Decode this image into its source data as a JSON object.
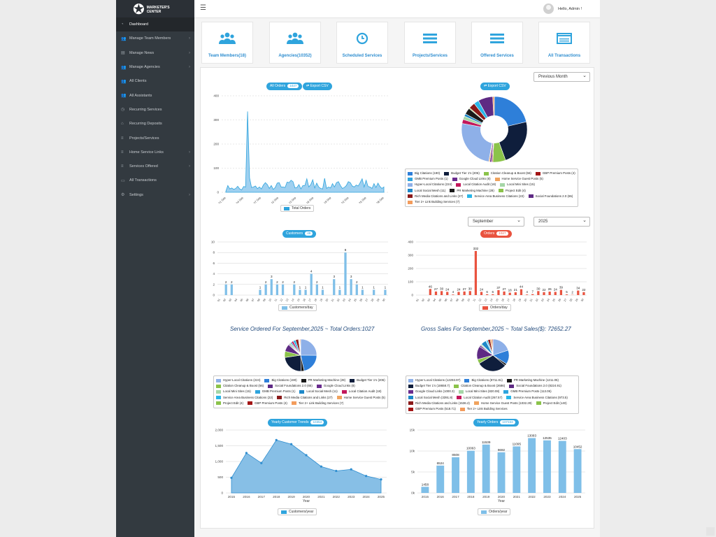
{
  "app": {
    "logo_text": "MARKETER'S CENTER",
    "greeting": "Hello, Admin !"
  },
  "sidebar": {
    "items": [
      {
        "label": "Dashboard",
        "icon": "dashboard-icon",
        "active": true,
        "arrow": false
      },
      {
        "label": "Manage Team Members",
        "icon": "users-icon",
        "arrow": true
      },
      {
        "label": "Manage News",
        "icon": "news-icon",
        "arrow": true
      },
      {
        "label": "Manage Agencies",
        "icon": "users-icon",
        "arrow": true
      },
      {
        "label": "All Clients",
        "icon": "users-icon",
        "arrow": false
      },
      {
        "label": "All Assistants",
        "icon": "users-icon",
        "arrow": false
      },
      {
        "label": "Recurring Services",
        "icon": "clock-icon",
        "arrow": false
      },
      {
        "label": "Recurring Deposits",
        "icon": "bank-icon",
        "arrow": false
      },
      {
        "label": "Projects/Services",
        "icon": "list-icon",
        "arrow": false
      },
      {
        "label": "Home Service Links",
        "icon": "list-icon",
        "arrow": true
      },
      {
        "label": "Services Offered",
        "icon": "list-icon",
        "arrow": true
      },
      {
        "label": "All Transactions",
        "icon": "card-icon",
        "arrow": false
      },
      {
        "label": "Settings",
        "icon": "gear-icon",
        "arrow": true
      }
    ]
  },
  "cards": [
    {
      "label": "Team Members(18)",
      "icon": "users-icon"
    },
    {
      "label": "Agencies(10352)",
      "icon": "users-icon"
    },
    {
      "label": "Scheduled Services",
      "icon": "clock-icon"
    },
    {
      "label": "Projects/Services",
      "icon": "list-icon"
    },
    {
      "label": "Offered Services",
      "icon": "list-icon"
    },
    {
      "label": "All Transactions",
      "icon": "card-icon"
    }
  ],
  "filters": {
    "period": "Previous Month",
    "month": "September",
    "year": "2025"
  },
  "buttons": {
    "all_orders": "All Orders",
    "all_orders_count": "1027",
    "export_csv": "Export CSV",
    "export_csv_2": "Export CSV"
  },
  "badges": {
    "customers": "Customers",
    "customers_count": "49",
    "orders": "Orders",
    "orders_count": "1027",
    "yearly_customers": "Yearly Customer Trends",
    "yearly_customers_count": "10354",
    "yearly_orders": "Yearly Orders",
    "yearly_orders_count": "107333"
  },
  "colors": {
    "accent": "#2fa4dd",
    "red": "#e9533f",
    "sidebar": "#333a40",
    "area": "#87bfe6",
    "bar": "#7fbfe8"
  },
  "palette": {
    "Big Citations": "#2e7fd9",
    "Budget Tier 1's": "#0f1e3c",
    "Citation Cleanup & Boost": "#8bc34a",
    "GBP Premium Posts": "#a31515",
    "GMB Premium Posts": "#2fa4dd",
    "Google Cloud Links": "#6a2c8e",
    "Home Service Guest Posts": "#f0a35e",
    "Hyper-Local Citations": "#8eb0e8",
    "Local Citation Audit": "#c2185b",
    "Local Mini Sites": "#a5d6a7",
    "Local Social Mesh": "#1e88c8",
    "PR Marketing Machine": "#1a1a1a",
    "Project Edit": "#8bc34a",
    "Rich Media Citations and Links": "#8b1a1a",
    "Service Area Business Citations": "#29b6e8",
    "Social Foundations 2.0": "#5e2a84",
    "Tier 2+ Link Building Services": "#f39c5c"
  },
  "chart_data": [
    {
      "type": "area",
      "x": [
        "01 Sep",
        "04 Sep",
        "07 Sep",
        "10 Sep",
        "13 Sep",
        "16 Sep",
        "19 Sep",
        "22 Sep",
        "25 Sep",
        "28 Sep"
      ],
      "series": [
        {
          "name": "Total Orders",
          "values": [
            4,
            28,
            14,
            18,
            12,
            16,
            25,
            14,
            10,
            24,
            22,
            335,
            60,
            20,
            22,
            26,
            15,
            22,
            14,
            30,
            40,
            32,
            16,
            28,
            12,
            20,
            38,
            40,
            22,
            22,
            20,
            42,
            40,
            50,
            44,
            18,
            20,
            32,
            14,
            28,
            28,
            56,
            22,
            32,
            52,
            18,
            38,
            22,
            16,
            14,
            58,
            16,
            22,
            18,
            36,
            22,
            40,
            44,
            28,
            16,
            20,
            28,
            44,
            40,
            26,
            22,
            30,
            26,
            40,
            56,
            22,
            50,
            24,
            22,
            16,
            36,
            20,
            38,
            24,
            16,
            22
          ]
        }
      ],
      "ylim": [
        0,
        400
      ],
      "yticks": [
        "400",
        "300",
        "200",
        "100",
        "0"
      ]
    },
    {
      "type": "pie",
      "title": "",
      "labels": [
        "Big Citations",
        "Budget Tier 1's",
        "Citation Cleanup & Boost",
        "GBP Premium Posts",
        "GMB Premium Posts",
        "Google Cloud Links",
        "Home Service Guest Posts",
        "Hyper-Local Citations",
        "Local Citation Audit",
        "Local Mini Sites",
        "Local Social Mesh",
        "PR Marketing Machine",
        "Project Edit",
        "Rich Media Citations and Links",
        "Service Area Business Citations",
        "Social Foundations 2.0",
        "Tier 2+ Link Building Services"
      ],
      "values": [
        190,
        206,
        56,
        4,
        1,
        8,
        5,
        224,
        18,
        15,
        11,
        28,
        4,
        27,
        22,
        65,
        7
      ]
    },
    {
      "type": "bar",
      "series": [
        {
          "name": "Customers/day",
          "values": [
            0,
            2,
            2,
            0,
            0,
            0,
            0,
            1,
            2,
            3,
            2,
            2,
            0,
            2,
            1,
            1,
            4,
            2,
            1,
            0,
            3,
            1,
            8,
            3,
            2,
            1,
            0,
            1,
            0,
            1
          ]
        }
      ],
      "categories": [
        "01",
        "02",
        "03",
        "04",
        "05",
        "06",
        "07",
        "08",
        "09",
        "10",
        "11",
        "12",
        "13",
        "14",
        "15",
        "16",
        "17",
        "18",
        "19",
        "20",
        "21",
        "22",
        "23",
        "24",
        "25",
        "26",
        "27",
        "28",
        "29",
        "30"
      ],
      "ylim": [
        0,
        10
      ],
      "yticks": [
        "10",
        "8",
        "6",
        "4",
        "2",
        "0"
      ]
    },
    {
      "type": "bar",
      "series": [
        {
          "name": "Orders/day",
          "values": [
            0,
            0,
            46,
            27,
            30,
            24,
            4,
            24,
            27,
            30,
            332,
            24,
            6,
            6,
            37,
            27,
            18,
            21,
            44,
            4,
            7,
            30,
            22,
            26,
            24,
            39,
            5,
            2,
            34,
            22
          ]
        }
      ],
      "categories": [
        "01",
        "02",
        "03",
        "04",
        "05",
        "06",
        "07",
        "08",
        "09",
        "10",
        "11",
        "12",
        "13",
        "14",
        "15",
        "16",
        "17",
        "18",
        "19",
        "20",
        "21",
        "22",
        "23",
        "24",
        "25",
        "26",
        "27",
        "28",
        "29",
        "30"
      ],
      "ylim": [
        0,
        400
      ],
      "yticks": [
        "400",
        "300",
        "200",
        "100",
        "0"
      ]
    },
    {
      "type": "pie",
      "title": "Service Ordered For September,2025 ~ Total Orders:1027",
      "labels": [
        "Hyper-Local Citations",
        "Big Citations",
        "PR Marketing Machine",
        "Budget Tier 1's",
        "Citation Cleanup & Boost",
        "Social Foundations 2.0",
        "Google Cloud Links",
        "Local Mini Sites",
        "GMB Premium Posts",
        "Local Social Mesh",
        "Local Citation Audit",
        "Service Area Business Citations",
        "Rich Media Citations and Links",
        "Home Service Guest Posts",
        "Project Edit",
        "GBP Premium Posts",
        "Tier 2+ Link Building Services"
      ],
      "values": [
        224,
        190,
        28,
        206,
        56,
        65,
        8,
        15,
        1,
        11,
        18,
        22,
        27,
        5,
        4,
        4,
        7
      ]
    },
    {
      "type": "pie",
      "title": "Gross Sales For September,2025 ~ Total Sales($): 72652.27",
      "labels": [
        "Hyper-Local Citations",
        "Big Citations",
        "PR Marketing Machine",
        "Budget Tier 1's",
        "Citation Cleanup & Boost",
        "Social Foundations 2.0",
        "Google Cloud Links",
        "Local Mini Sites",
        "GMB Premium Posts",
        "Local Social Mesh",
        "Local Citation Audit",
        "Service Area Business Citations",
        "Rich Media Citations and Links",
        "Home Service Guest Posts",
        "Project Edit",
        "GBP Premium Posts",
        "Tier 2+ Link Building Services"
      ],
      "values": [
        12293.97,
        8711.81,
        1211.05,
        18658.7,
        2686,
        8224.91,
        1000.3,
        820.08,
        113.05,
        3391.8,
        267.57,
        973.5,
        1536.2,
        1032.29,
        140,
        518.71,
        0
      ],
      "value_labels": [
        "12293.97",
        "8711.81",
        "1211.05",
        "18658.7",
        "2686",
        "8224.91",
        "1000.3",
        "820.08",
        "113.05",
        "3391.8",
        "267.57",
        "973.5",
        "1536.2",
        "1032.29",
        "140",
        "518.71"
      ]
    },
    {
      "type": "area",
      "x": [
        "2015",
        "2016",
        "2017",
        "2018",
        "2019",
        "2020",
        "2021",
        "2022",
        "2023",
        "2024",
        "2025"
      ],
      "series": [
        {
          "name": "Customers/year",
          "values": [
            480,
            1270,
            950,
            1680,
            1550,
            1200,
            840,
            700,
            750,
            540,
            430
          ]
        }
      ],
      "ylim": [
        0,
        2000
      ],
      "xlabel": "Year",
      "yticks": [
        "2,000",
        "1,500",
        "1,000",
        "500",
        "0"
      ]
    },
    {
      "type": "bar",
      "categories": [
        "2015",
        "2016",
        "2017",
        "2018",
        "2019",
        "2020",
        "2021",
        "2022",
        "2023",
        "2024",
        "2025"
      ],
      "series": [
        {
          "name": "Orders/year",
          "values": [
            1458,
            6524,
            8508,
            10063,
            11539,
            9692,
            11095,
            13083,
            12535,
            12403,
            10452
          ]
        }
      ],
      "ylim": [
        0,
        15000
      ],
      "xlabel": "Year",
      "yticks": [
        "15k",
        "10k",
        "5k",
        "0k"
      ]
    }
  ]
}
